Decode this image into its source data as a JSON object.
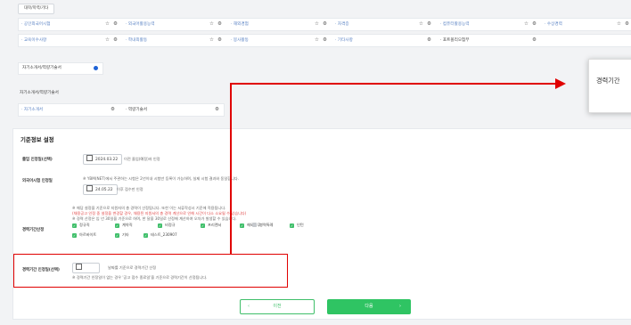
{
  "top_tab": "대학/학력/기타",
  "row1": [
    {
      "label": "· 공인외국어시험",
      "icons": [
        "☆",
        "⚙"
      ]
    },
    {
      "label": "· 외국어활용능력",
      "icons": [
        "☆",
        "⚙"
      ]
    },
    {
      "label": "· 해외경험",
      "icons": [
        "☆",
        "⚙"
      ]
    },
    {
      "label": "· 자격증",
      "icons": [
        "☆",
        "⚙"
      ]
    },
    {
      "label": "· 컴퓨터활용능력",
      "icons": [
        "☆",
        "⚙"
      ]
    },
    {
      "label": "· 수상경력",
      "icons": [
        "☆",
        "⚙"
      ]
    }
  ],
  "row2": [
    {
      "label": "· 교육이수사항",
      "icons": [
        "☆",
        "⚙"
      ]
    },
    {
      "label": "· 학내외활동",
      "icons": [
        "☆",
        "⚙"
      ]
    },
    {
      "label": "· 봉사활동",
      "icons": [
        "☆",
        "⚙"
      ]
    },
    {
      "label": "· 기타사항",
      "icons": [
        "⚙"
      ]
    },
    {
      "label": "· 포트폴리오첨부",
      "icons": [
        "⚙"
      ]
    }
  ],
  "intro_box": "자기소개서/역량기술서",
  "intro_section": "자기소개서/역량기술서",
  "intro_items": [
    {
      "label": "· 자기소개서",
      "icon": "⚙"
    },
    {
      "label": "· 역량기술서",
      "icon": "⚙"
    }
  ],
  "form": {
    "title": "기준정보 설정",
    "grad": {
      "label": "졸업 인정일(선택)",
      "date": "2024.03.22",
      "note": "이전 졸업(예정)자 인정"
    },
    "foreign": {
      "label": "외국어시험 인정일",
      "note1": "※ YBM(NET)에서 주관하는 시험은 2년이내 시험만 등록이 가능하며, 실제 시험 결과와 동일합니다.",
      "date": "24.05.22",
      "note2": "이후 점수만 인정"
    },
    "career": {
      "label": "경력기간산정",
      "note1": "※ 해당 설정을 기준으로 지원자의 총 경력이 산정됩니다. 또한 이는 서류작성시 기준에 적용됩니다.",
      "note_red": "(채용공고 인정 중 설정을 변경할 경우, 채용된 지원서의 총 경력 계산으로 인해 시간이 다소 소요될 수 있습니다)",
      "note3": "※ 경력 산정은 입 년 30일을 기준으로 하며, 한 달을 30일로 산정해 계산하여 오차가 발생할 수 있습니다.",
      "checks1": [
        {
          "label": "정규직",
          "on": true
        },
        {
          "label": "계약직",
          "on": true
        },
        {
          "label": "비정규",
          "on": true
        },
        {
          "label": "프리랜서",
          "on": true
        },
        {
          "label": "해외근무",
          "on": true
        },
        {
          "label": "병역특례",
          "on": false
        },
        {
          "label": "인턴",
          "on": true
        }
      ],
      "checks2": [
        {
          "label": "아르바이트",
          "on": true
        },
        {
          "label": "기타",
          "on": true
        },
        {
          "label": "테스트_230907",
          "on": true
        }
      ]
    },
    "career_date": {
      "label": "경력기간 인정일(선택)",
      "note": "날짜를 기준으로 경력기간 산정",
      "sub": "※ 경력기간 인정일이 없는 경우 '공고 접수 종료일'을 기준으로 경력기간이 산정됩니다."
    }
  },
  "buttons": {
    "prev": "이전",
    "next": "다음",
    "prev_icon": "‹",
    "next_icon": "›"
  },
  "tooltip_text": "경력기간",
  "colors": {
    "accent_green": "#2fc463",
    "link_blue": "#5b83c4",
    "annotation_red": "#e00000"
  }
}
